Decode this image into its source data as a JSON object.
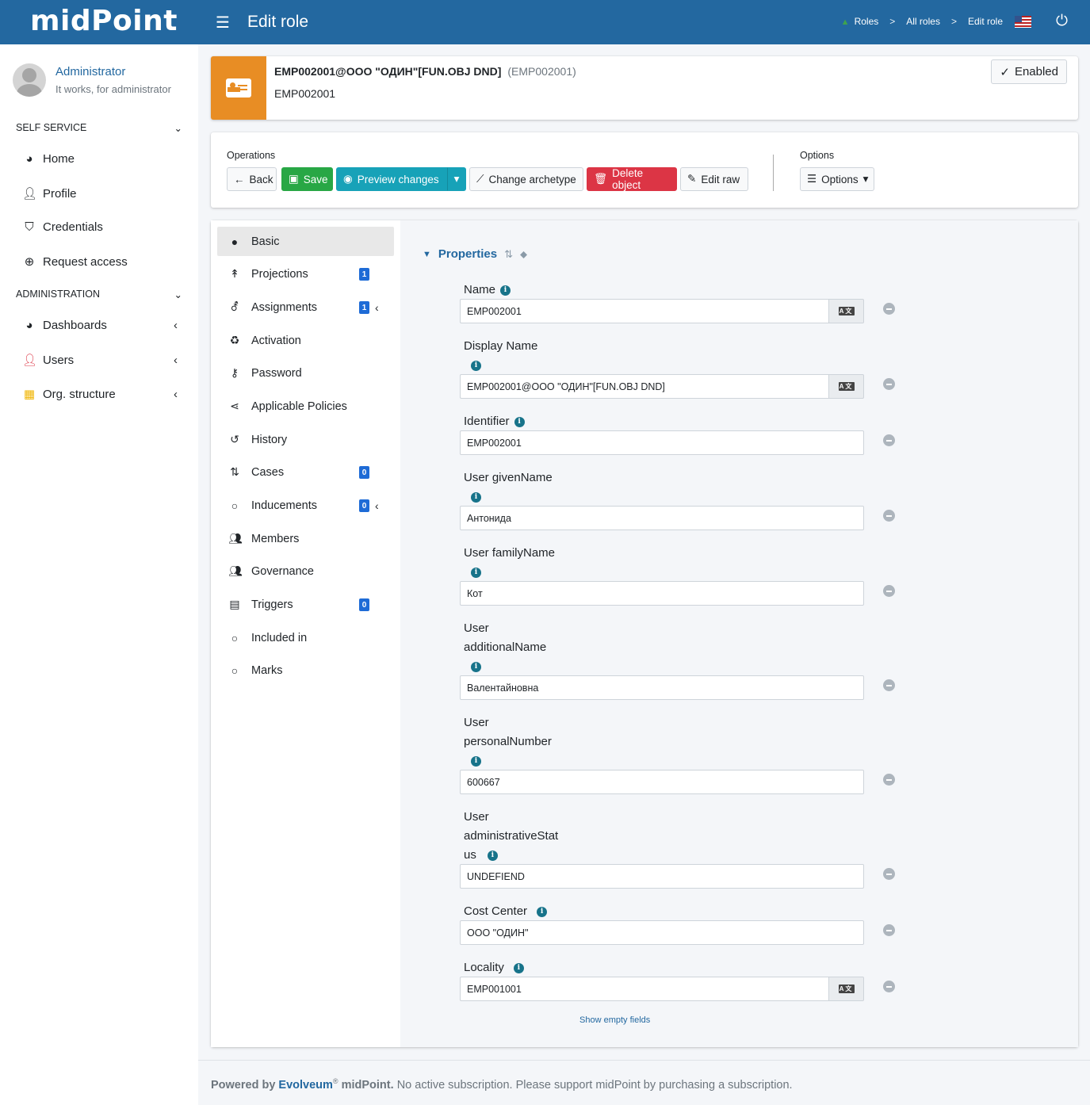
{
  "header": {
    "logo": "midPoint",
    "title": "Edit role",
    "breadcrumbs": [
      "Roles",
      "All roles",
      "Edit role"
    ],
    "separator": ">"
  },
  "user": {
    "name": "Administrator",
    "subtitle": "It works, for administrator"
  },
  "sidebar": {
    "self_service": {
      "title": "SELF SERVICE",
      "items": [
        {
          "label": "Home",
          "icon": "dashboard-icon"
        },
        {
          "label": "Profile",
          "icon": "user-icon"
        },
        {
          "label": "Credentials",
          "icon": "shield-icon"
        },
        {
          "label": "Request access",
          "icon": "plus-circle-icon"
        }
      ]
    },
    "administration": {
      "title": "ADMINISTRATION",
      "items": [
        {
          "label": "Dashboards",
          "icon": "dashboard-icon"
        },
        {
          "label": "Users",
          "icon": "user-icon",
          "color": "#dc3545"
        },
        {
          "label": "Org. structure",
          "icon": "building-icon",
          "color": "#f0b400"
        }
      ]
    }
  },
  "summary": {
    "title": "EMP002001@ООО \"ОДИН\"[FUN.OBJ DND]",
    "oid": "(EMP002001)",
    "subtitle": "EMP002001",
    "status": "Enabled",
    "icon_color": "#e88d24"
  },
  "operations": {
    "label": "Operations",
    "back": "Back",
    "save": "Save",
    "preview": "Preview changes",
    "change_archetype": "Change archetype",
    "delete": "Delete object",
    "edit_raw": "Edit raw",
    "options_label": "Options",
    "options_button": "Options"
  },
  "nav": {
    "basic": "Basic",
    "projections": "Projections",
    "projections_count": "1",
    "assignments": "Assignments",
    "assignments_count": "1",
    "activation": "Activation",
    "password": "Password",
    "applicable_policies": "Applicable Policies",
    "history": "History",
    "cases": "Cases",
    "cases_count": "0",
    "inducements": "Inducements",
    "inducements_count": "0",
    "members": "Members",
    "governance": "Governance",
    "triggers": "Triggers",
    "triggers_count": "0",
    "included_in": "Included in",
    "marks": "Marks"
  },
  "properties": {
    "title": "Properties",
    "name": {
      "label": "Name",
      "value": "EMP002001"
    },
    "display_name": {
      "label": "Display Name",
      "value": "EMP002001@ООО \"ОДИН\"[FUN.OBJ DND]"
    },
    "identifier": {
      "label": "Identifier",
      "value": "EMP002001"
    },
    "given_name": {
      "label": "User givenName",
      "value": "Антонида"
    },
    "family_name": {
      "label": "User familyName",
      "value": "Кот"
    },
    "additional_name": {
      "label_1": "User",
      "label_2": "additionalName",
      "value": "Валентайновна"
    },
    "personal_number": {
      "label_1": "User",
      "label_2": "personalNumber",
      "value": "600667"
    },
    "administrative_status": {
      "label_1": "User",
      "label_2": "administrativeStat",
      "label_3": "us",
      "value": "UNDEFIEND"
    },
    "cost_center": {
      "label": "Cost Center",
      "value": "ООО \"ОДИН\""
    },
    "locality": {
      "label": "Locality",
      "value": "EMP001001"
    },
    "show_empty": "Show empty fields"
  },
  "footer": {
    "powered_by": "Powered by",
    "brand": "Evolveum",
    "reg": "®",
    "product": "midPoint.",
    "message": "No active subscription. Please support midPoint by purchasing a subscription."
  }
}
